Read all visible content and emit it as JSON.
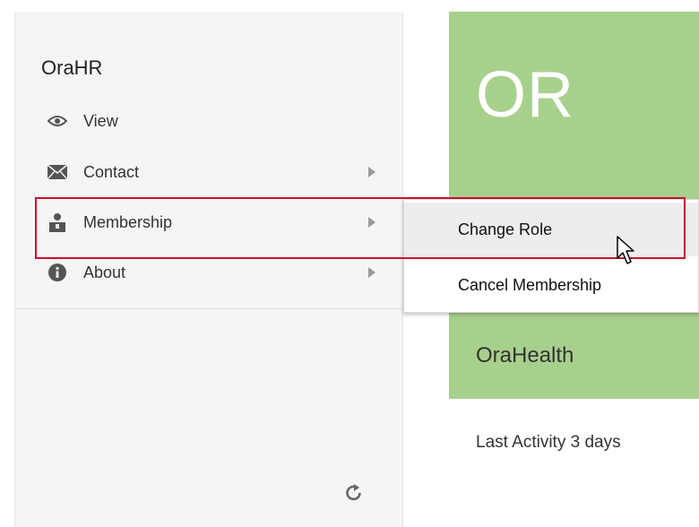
{
  "menu": {
    "title": "OraHR",
    "items": [
      {
        "label": "View",
        "icon": "eye-icon",
        "has_submenu": false
      },
      {
        "label": "Contact",
        "icon": "envelope-icon",
        "has_submenu": true
      },
      {
        "label": "Membership",
        "icon": "membership-icon",
        "has_submenu": true
      },
      {
        "label": "About",
        "icon": "info-icon",
        "has_submenu": true
      }
    ]
  },
  "submenu": {
    "items": [
      {
        "label": "Change Role"
      },
      {
        "label": "Cancel Membership"
      }
    ]
  },
  "tile": {
    "initials": "OR",
    "name": "OraHealth",
    "activity": "Last Activity 3 days",
    "color": "#a8d08d"
  },
  "colors": {
    "highlight": "#c8102e",
    "menu_background": "#f5f5f5"
  }
}
